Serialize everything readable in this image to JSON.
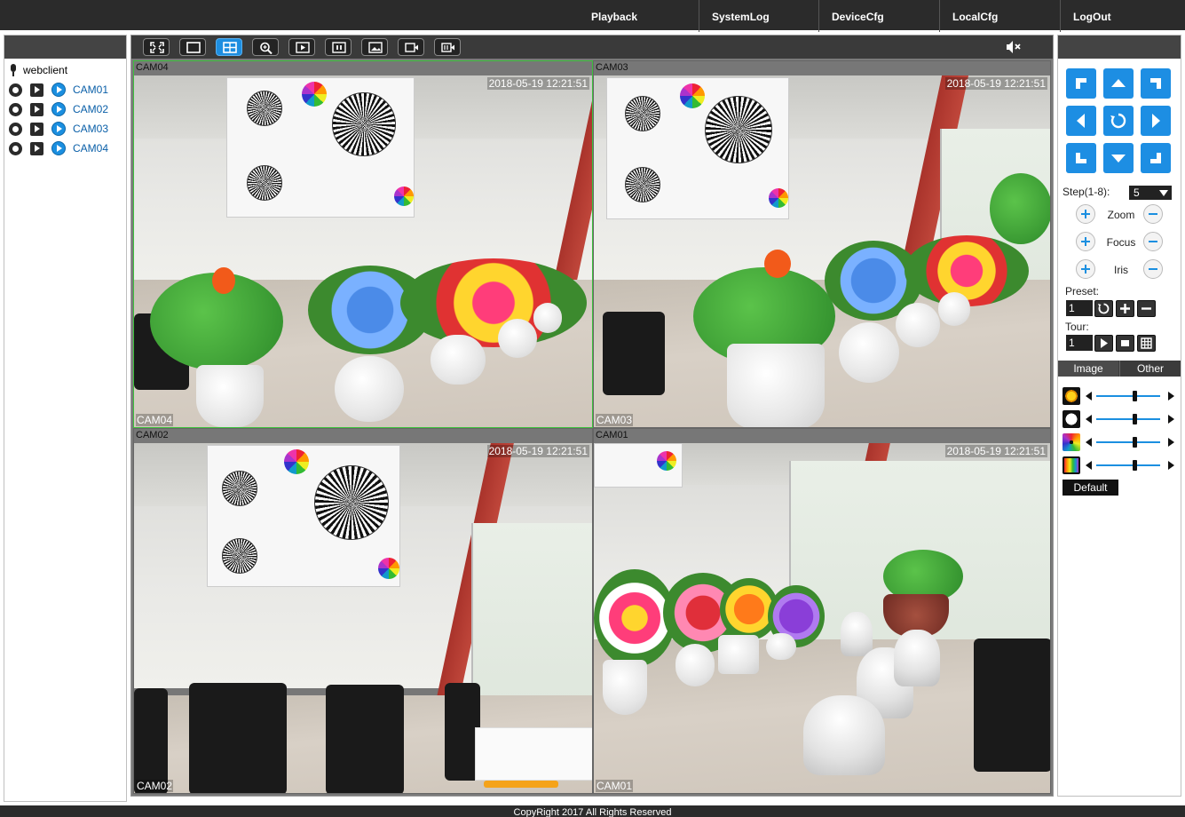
{
  "nav": {
    "items": [
      {
        "label": "Playback"
      },
      {
        "label": "SystemLog"
      },
      {
        "label": "DeviceCfg"
      },
      {
        "label": "LocalCfg"
      },
      {
        "label": "LogOut"
      }
    ]
  },
  "left_panel": {
    "root_label": "webclient",
    "cameras": [
      {
        "label": "CAM01"
      },
      {
        "label": "CAM02"
      },
      {
        "label": "CAM03"
      },
      {
        "label": "CAM04"
      }
    ]
  },
  "toolbar": {
    "icons": [
      "fullscreen-icon",
      "single-view-icon",
      "quad-view-icon",
      "zoom-icon",
      "play-icon",
      "pause-icon",
      "snapshot-icon",
      "record-icon",
      "record-all-icon",
      "mute-icon"
    ],
    "active": "quad-view-icon"
  },
  "tiles": [
    {
      "name": "CAM04",
      "timestamp": "2018-05-19 12:21:51",
      "selected": true
    },
    {
      "name": "CAM03",
      "timestamp": "2018-05-19 12:21:51",
      "selected": false
    },
    {
      "name": "CAM02",
      "timestamp": "2018-05-19 12:21:51",
      "selected": false
    },
    {
      "name": "CAM01",
      "timestamp": "2018-05-19 12:21:51",
      "selected": false
    }
  ],
  "ptz": {
    "step_label": "Step(1-8):",
    "step_value": "5",
    "zoom_label": "Zoom",
    "focus_label": "Focus",
    "iris_label": "Iris",
    "preset_label": "Preset:",
    "preset_value": "1",
    "tour_label": "Tour:",
    "tour_value": "1"
  },
  "image_settings": {
    "tabs": [
      {
        "label": "Image"
      },
      {
        "label": "Other"
      }
    ],
    "active_tab": "Image",
    "sliders": [
      {
        "icon": "brightness-icon",
        "level": 0.6
      },
      {
        "icon": "contrast-icon",
        "level": 0.6
      },
      {
        "icon": "saturation-icon",
        "level": 0.6
      },
      {
        "icon": "hue-icon",
        "level": 0.6
      }
    ],
    "default_label": "Default"
  },
  "colors": {
    "accent": "#1d8ee3",
    "selected_border": "#3cc13c",
    "header_bg": "#2b2b2b"
  },
  "footer": {
    "text": "CopyRight 2017 All Rights Reserved"
  }
}
